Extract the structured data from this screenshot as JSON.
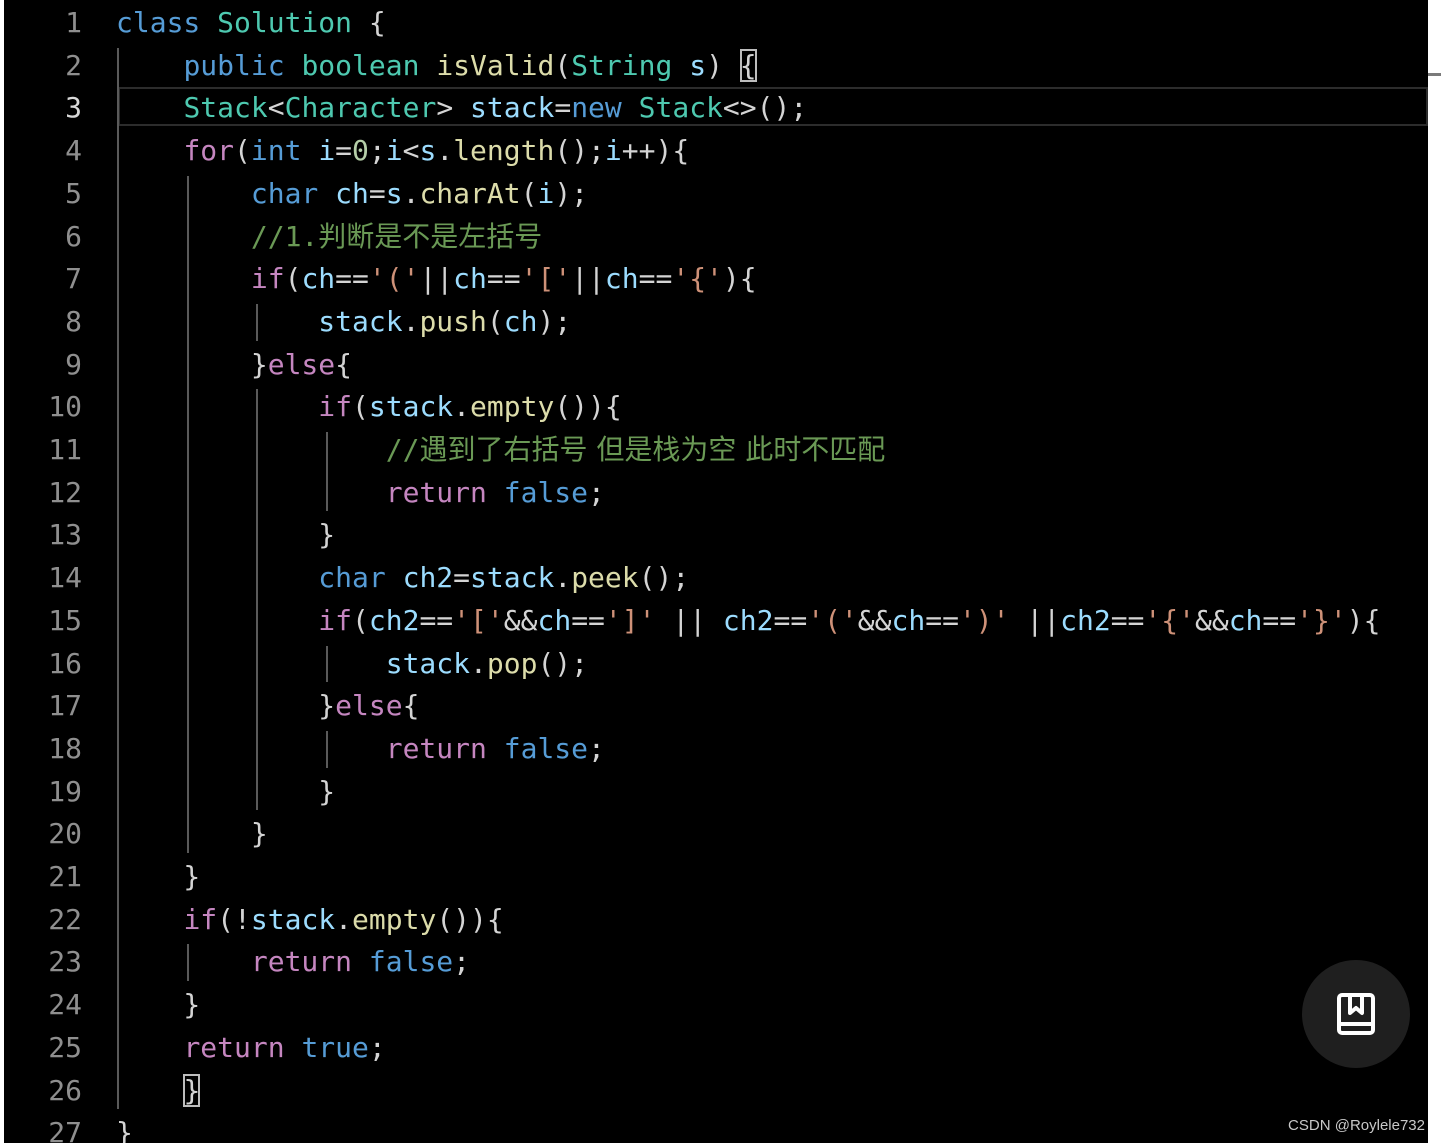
{
  "line_numbers": [
    "1",
    "2",
    "3",
    "4",
    "5",
    "6",
    "7",
    "8",
    "9",
    "10",
    "11",
    "12",
    "13",
    "14",
    "15",
    "16",
    "17",
    "18",
    "19",
    "20",
    "21",
    "22",
    "23",
    "24",
    "25",
    "26",
    "27"
  ],
  "lines": [
    [
      [
        "kw",
        "class"
      ],
      [
        "p",
        " "
      ],
      [
        "typ",
        "Solution"
      ],
      [
        "p",
        " {"
      ]
    ],
    [
      [
        "p",
        "    "
      ],
      [
        "kw",
        "public"
      ],
      [
        "p",
        " "
      ],
      [
        "typ",
        "boolean"
      ],
      [
        "p",
        " "
      ],
      [
        "fn",
        "isValid"
      ],
      [
        "p",
        "("
      ],
      [
        "typ",
        "String"
      ],
      [
        "p",
        " "
      ],
      [
        "var",
        "s"
      ],
      [
        "p",
        ") "
      ],
      [
        "p-hl",
        "{"
      ]
    ],
    [
      [
        "p",
        "    "
      ],
      [
        "typ",
        "Stack"
      ],
      [
        "p",
        "<"
      ],
      [
        "typ",
        "Character"
      ],
      [
        "p",
        "> "
      ],
      [
        "var",
        "stack"
      ],
      [
        "p",
        "="
      ],
      [
        "kw",
        "new"
      ],
      [
        "p",
        " "
      ],
      [
        "typ",
        "Stack"
      ],
      [
        "p",
        "<>();"
      ]
    ],
    [
      [
        "p",
        "    "
      ],
      [
        "ctl",
        "for"
      ],
      [
        "p",
        "("
      ],
      [
        "kw",
        "int"
      ],
      [
        "p",
        " "
      ],
      [
        "var",
        "i"
      ],
      [
        "p",
        "="
      ],
      [
        "num",
        "0"
      ],
      [
        "p",
        ";"
      ],
      [
        "var",
        "i"
      ],
      [
        "p",
        "<"
      ],
      [
        "var",
        "s"
      ],
      [
        "p",
        "."
      ],
      [
        "fn",
        "length"
      ],
      [
        "p",
        "();"
      ],
      [
        "var",
        "i"
      ],
      [
        "p",
        "++){"
      ]
    ],
    [
      [
        "p",
        "        "
      ],
      [
        "kw",
        "char"
      ],
      [
        "p",
        " "
      ],
      [
        "var",
        "ch"
      ],
      [
        "p",
        "="
      ],
      [
        "var",
        "s"
      ],
      [
        "p",
        "."
      ],
      [
        "fn",
        "charAt"
      ],
      [
        "p",
        "("
      ],
      [
        "var",
        "i"
      ],
      [
        "p",
        ");"
      ]
    ],
    [
      [
        "p",
        "        "
      ],
      [
        "cmt",
        "//1."
      ],
      [
        "cmtc",
        "判断是不是左括号"
      ]
    ],
    [
      [
        "p",
        "        "
      ],
      [
        "ctl",
        "if"
      ],
      [
        "p",
        "("
      ],
      [
        "var",
        "ch"
      ],
      [
        "p",
        "=="
      ],
      [
        "str",
        "'('"
      ],
      [
        "p",
        "||"
      ],
      [
        "var",
        "ch"
      ],
      [
        "p",
        "=="
      ],
      [
        "str",
        "'['"
      ],
      [
        "p",
        "||"
      ],
      [
        "var",
        "ch"
      ],
      [
        "p",
        "=="
      ],
      [
        "str",
        "'{'"
      ],
      [
        "p",
        "){"
      ]
    ],
    [
      [
        "p",
        "            "
      ],
      [
        "var",
        "stack"
      ],
      [
        "p",
        "."
      ],
      [
        "fn",
        "push"
      ],
      [
        "p",
        "("
      ],
      [
        "var",
        "ch"
      ],
      [
        "p",
        ");"
      ]
    ],
    [
      [
        "p",
        "        }"
      ],
      [
        "ctl",
        "else"
      ],
      [
        "p",
        "{"
      ]
    ],
    [
      [
        "p",
        "            "
      ],
      [
        "ctl",
        "if"
      ],
      [
        "p",
        "("
      ],
      [
        "var",
        "stack"
      ],
      [
        "p",
        "."
      ],
      [
        "fn",
        "empty"
      ],
      [
        "p",
        "()){"
      ]
    ],
    [
      [
        "p",
        "                "
      ],
      [
        "cmt",
        "//"
      ],
      [
        "cmtc",
        "遇到了右括号 但是栈为空 此时不匹配"
      ]
    ],
    [
      [
        "p",
        "                "
      ],
      [
        "ctl",
        "return"
      ],
      [
        "p",
        " "
      ],
      [
        "kw",
        "false"
      ],
      [
        "p",
        ";"
      ]
    ],
    [
      [
        "p",
        "            }"
      ]
    ],
    [
      [
        "p",
        "            "
      ],
      [
        "kw",
        "char"
      ],
      [
        "p",
        " "
      ],
      [
        "var",
        "ch2"
      ],
      [
        "p",
        "="
      ],
      [
        "var",
        "stack"
      ],
      [
        "p",
        "."
      ],
      [
        "fn",
        "peek"
      ],
      [
        "p",
        "();"
      ]
    ],
    [
      [
        "p",
        "            "
      ],
      [
        "ctl",
        "if"
      ],
      [
        "p",
        "("
      ],
      [
        "var",
        "ch2"
      ],
      [
        "p",
        "=="
      ],
      [
        "str",
        "'['"
      ],
      [
        "p",
        "&&"
      ],
      [
        "var",
        "ch"
      ],
      [
        "p",
        "=="
      ],
      [
        "str",
        "']'"
      ],
      [
        "p",
        " || "
      ],
      [
        "var",
        "ch2"
      ],
      [
        "p",
        "=="
      ],
      [
        "str",
        "'('"
      ],
      [
        "p",
        "&&"
      ],
      [
        "var",
        "ch"
      ],
      [
        "p",
        "=="
      ],
      [
        "str",
        "')'"
      ],
      [
        "p",
        " ||"
      ],
      [
        "var",
        "ch2"
      ],
      [
        "p",
        "=="
      ],
      [
        "str",
        "'{'"
      ],
      [
        "p",
        "&&"
      ],
      [
        "var",
        "ch"
      ],
      [
        "p",
        "=="
      ],
      [
        "str",
        "'}'"
      ],
      [
        "p",
        "){"
      ]
    ],
    [
      [
        "p",
        "                "
      ],
      [
        "var",
        "stack"
      ],
      [
        "p",
        "."
      ],
      [
        "fn",
        "pop"
      ],
      [
        "p",
        "();"
      ]
    ],
    [
      [
        "p",
        "            }"
      ],
      [
        "ctl",
        "else"
      ],
      [
        "p",
        "{"
      ]
    ],
    [
      [
        "p",
        "                "
      ],
      [
        "ctl",
        "return"
      ],
      [
        "p",
        " "
      ],
      [
        "kw",
        "false"
      ],
      [
        "p",
        ";"
      ]
    ],
    [
      [
        "p",
        "            }"
      ]
    ],
    [
      [
        "p",
        "        }"
      ]
    ],
    [
      [
        "p",
        "    }"
      ]
    ],
    [
      [
        "p",
        "    "
      ],
      [
        "ctl",
        "if"
      ],
      [
        "p",
        "(!"
      ],
      [
        "var",
        "stack"
      ],
      [
        "p",
        "."
      ],
      [
        "fn",
        "empty"
      ],
      [
        "p",
        "()){"
      ]
    ],
    [
      [
        "p",
        "        "
      ],
      [
        "ctl",
        "return"
      ],
      [
        "p",
        " "
      ],
      [
        "kw",
        "false"
      ],
      [
        "p",
        ";"
      ]
    ],
    [
      [
        "p",
        "    }"
      ]
    ],
    [
      [
        "p",
        "    "
      ],
      [
        "ctl",
        "return"
      ],
      [
        "p",
        " "
      ],
      [
        "kw",
        "true"
      ],
      [
        "p",
        ";"
      ]
    ],
    [
      [
        "p",
        "    "
      ],
      [
        "p-hl",
        "}"
      ]
    ],
    [
      [
        "p",
        "}"
      ]
    ]
  ],
  "current_line": 3,
  "icons": {
    "bookmark": "bookmark-book-icon"
  },
  "watermark": "CSDN @Roylele732",
  "colors": {
    "background": "#000000",
    "keyword": "#569cd6",
    "control": "#c586c0",
    "type": "#4ec9b0",
    "variable": "#9cdcfe",
    "function": "#dcdcaa",
    "number": "#b5cea8",
    "string": "#ce9178",
    "comment": "#6a9955",
    "punctuation": "#d4d4d4"
  }
}
